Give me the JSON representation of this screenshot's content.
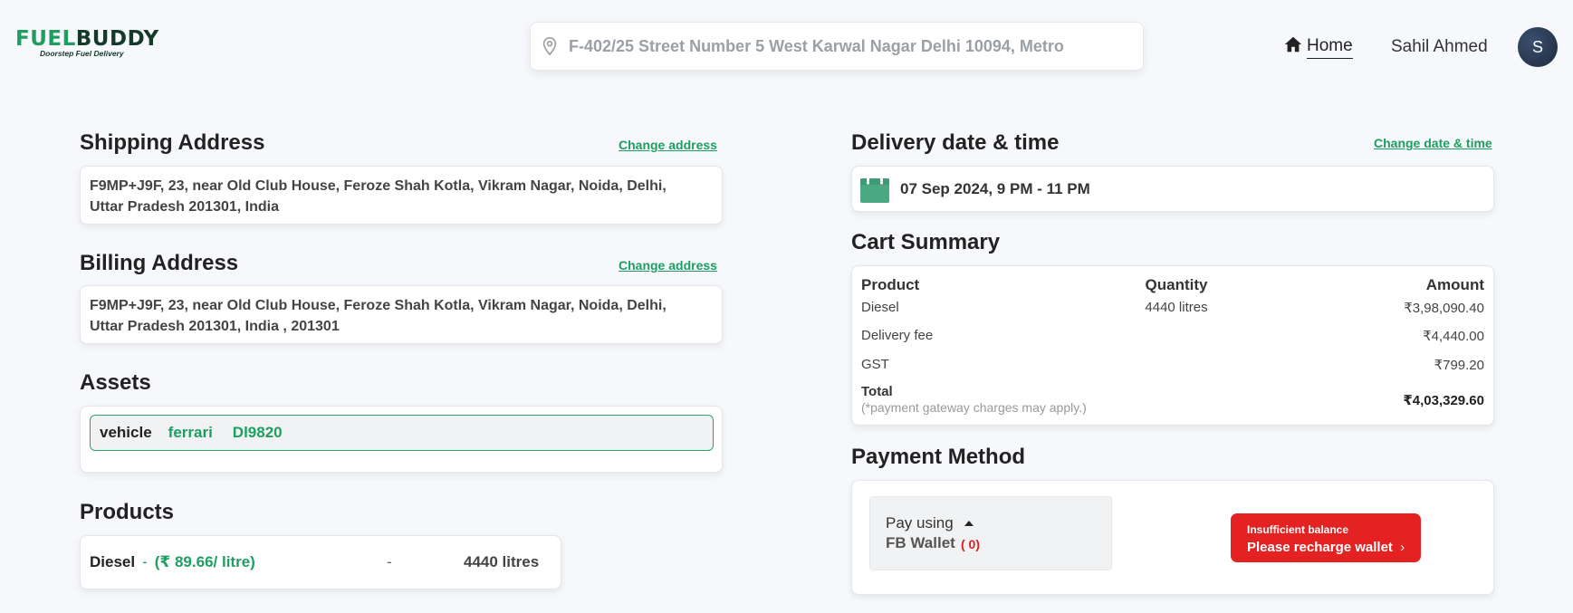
{
  "header": {
    "logo": {
      "part1": "FUEL",
      "part2": "BUDDY",
      "tagline": "Doorstep Fuel Delivery"
    },
    "search": {
      "value": "F-402/25 Street Number 5 West Karwal Nagar Delhi 10094, Metro"
    },
    "nav": {
      "home_label": "Home",
      "user_name": "Sahil Ahmed",
      "avatar_initial": "S"
    }
  },
  "shipping": {
    "title": "Shipping Address",
    "change_label": "Change address",
    "line1": "F9MP+J9F, 23, near Old Club House, Feroze Shah Kotla, Vikram Nagar, Noida, Delhi,",
    "line2": "Uttar Pradesh 201301, India"
  },
  "billing": {
    "title": "Billing Address",
    "change_label": "Change address",
    "line1": "F9MP+J9F, 23, near Old Club House, Feroze Shah Kotla, Vikram Nagar, Noida, Delhi,",
    "line2": "Uttar Pradesh 201301, India , 201301"
  },
  "assets": {
    "title": "Assets",
    "type": "vehicle",
    "name": "ferrari",
    "number": "Dl9820"
  },
  "products": {
    "title": "Products",
    "name": "Diesel",
    "dash": "-",
    "price": "(₹ 89.66/ litre)",
    "separator": "-",
    "quantity": "4440 litres"
  },
  "delivery": {
    "title": "Delivery date & time",
    "change_label": "Change date & time",
    "value": "07 Sep 2024, 9 PM - 11 PM"
  },
  "cart": {
    "title": "Cart Summary",
    "headers": {
      "product": "Product",
      "quantity": "Quantity",
      "amount": "Amount"
    },
    "rows": [
      {
        "product": "Diesel",
        "quantity": "4440 litres",
        "amount": "₹3,98,090.40"
      },
      {
        "product": "Delivery fee",
        "quantity": "",
        "amount": "₹4,440.00"
      },
      {
        "product": "GST",
        "quantity": "",
        "amount": "₹799.20"
      }
    ],
    "total": {
      "label": "Total",
      "note": "(*payment gateway charges may apply.)",
      "amount": "₹4,03,329.60"
    }
  },
  "payment": {
    "title": "Payment Method",
    "pay_using": "Pay using",
    "wallet": "FB Wallet",
    "balance": "( 0)",
    "insufficient": "Insufficient balance",
    "recharge": "Please recharge wallet"
  },
  "colors": {
    "brand_green": "#1e9e61",
    "brand_dark": "#143a2a",
    "alert_red": "#e52222"
  }
}
